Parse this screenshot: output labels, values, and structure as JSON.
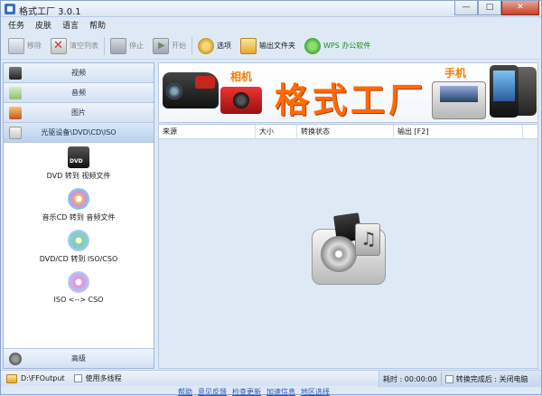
{
  "window": {
    "title": "格式工厂 3.0.1",
    "buttons": {
      "minimize": "—",
      "maximize": "□",
      "close": "✕"
    }
  },
  "menu": [
    "任务",
    "皮肤",
    "语言",
    "帮助"
  ],
  "toolbar": [
    {
      "label": "移除",
      "icon": "remove-icon",
      "enabled": false
    },
    {
      "label": "清空列表",
      "icon": "clear-list-icon",
      "enabled": false
    },
    {
      "label": "停止",
      "icon": "stop-icon",
      "enabled": false
    },
    {
      "label": "开始",
      "icon": "start-icon",
      "enabled": false
    },
    {
      "label": "选项",
      "icon": "options-icon",
      "enabled": true
    },
    {
      "label": "输出文件夹",
      "icon": "folder-icon",
      "enabled": true
    },
    {
      "label": "WPS 办公软件",
      "icon": "wps-icon",
      "enabled": true
    }
  ],
  "sidebar": {
    "categories": [
      {
        "label": "视频",
        "icon": "video-icon"
      },
      {
        "label": "音频",
        "icon": "audio-icon"
      },
      {
        "label": "图片",
        "icon": "picture-icon"
      },
      {
        "label": "光驱设备\\DVD\\CD\\ISO",
        "icon": "disc-drive-icon"
      }
    ],
    "disc_items": [
      {
        "label": "DVD 转到 视频文件",
        "icon": "dvd-icon"
      },
      {
        "label": "音乐CD 转到 音频文件",
        "icon": "music-cd-icon"
      },
      {
        "label": "DVD/CD 转到 ISO/CSO",
        "icon": "iso-icon"
      },
      {
        "label": "ISO <--> CSO",
        "icon": "cso-icon"
      }
    ],
    "advanced": {
      "label": "高级",
      "icon": "advanced-icon"
    }
  },
  "banner": {
    "tag_camera": "相机",
    "main_text": "格式工厂",
    "tag_phone": "手机"
  },
  "list": {
    "columns": [
      "来源",
      "大小",
      "转换状态",
      "输出 [F2]"
    ]
  },
  "status": {
    "output_path": "D:\\FFOutput",
    "multithread_label": "使用多线程",
    "elapsed": "耗时 : 00:00:00",
    "after_complete": "转换完成后 : 关闭电脑"
  },
  "bottom_links": [
    "帮助",
    "意见反馈",
    "检查更新",
    "加速信息",
    "地区选择"
  ],
  "colors": {
    "accent": "#ff6a00",
    "wps_green": "#1e8a1e",
    "close_red": "#c7412a"
  }
}
